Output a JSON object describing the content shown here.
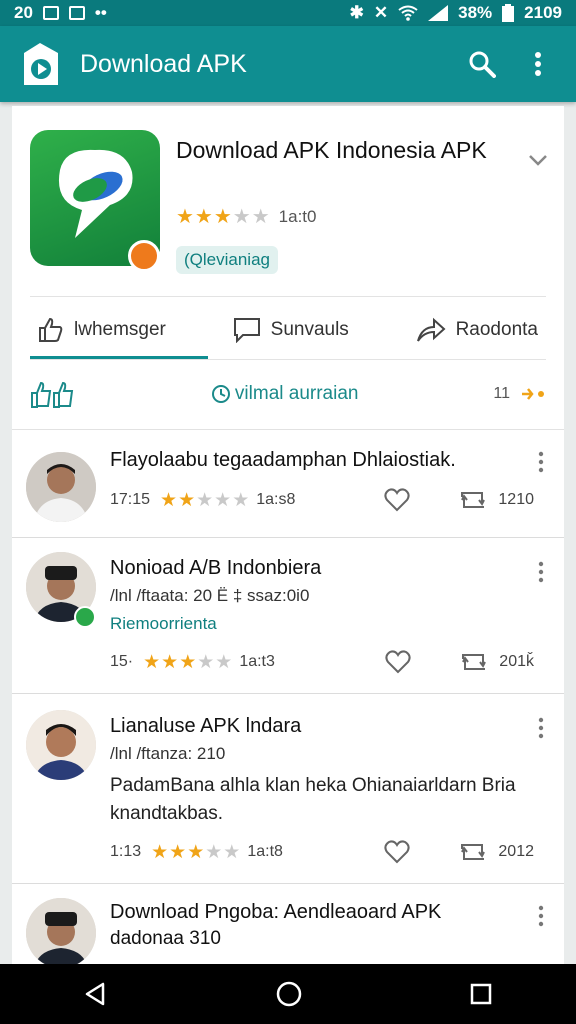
{
  "status_bar": {
    "time_left": "20",
    "battery": "38%",
    "time_right": "2109"
  },
  "app_bar": {
    "title": "Download APK"
  },
  "app_card": {
    "name": "Download APK Indonesia APK",
    "rating_count": "1a:t0",
    "tag": "(Qlevianiag",
    "tabs": [
      "lwhemsger",
      "Sunvauls",
      "Raodonta"
    ],
    "sort_label": "vilmal aurraian",
    "sort_count": "11"
  },
  "reviews": [
    {
      "title": "Flayolaabu tegaadamphan Dhlaiostiak.",
      "stat_left": "17:15",
      "stat_mid": "1a:s8",
      "stat_right": "1210"
    },
    {
      "title": "Nonioad A/B Indonbiera",
      "meta": "/lnl /ftaata: 20 Ë ‡ ssaz:0i0",
      "tag": "Riemoorrienta",
      "stat_left": "15·",
      "stat_mid": "1a:t3",
      "stat_right": "201ǩ"
    },
    {
      "title": "Lianaluse APK lndara",
      "meta": "/lnl /ftanza: 210",
      "body": "PadamBana alhla klan heka Ohianaiarldarn Bria knandtakbas.",
      "stat_left": "1:13",
      "stat_mid": "1a:t8",
      "stat_right": "2012"
    },
    {
      "title": "Download Pngoba: Aendleaoard APK",
      "meta": "dadonaa 310"
    }
  ]
}
